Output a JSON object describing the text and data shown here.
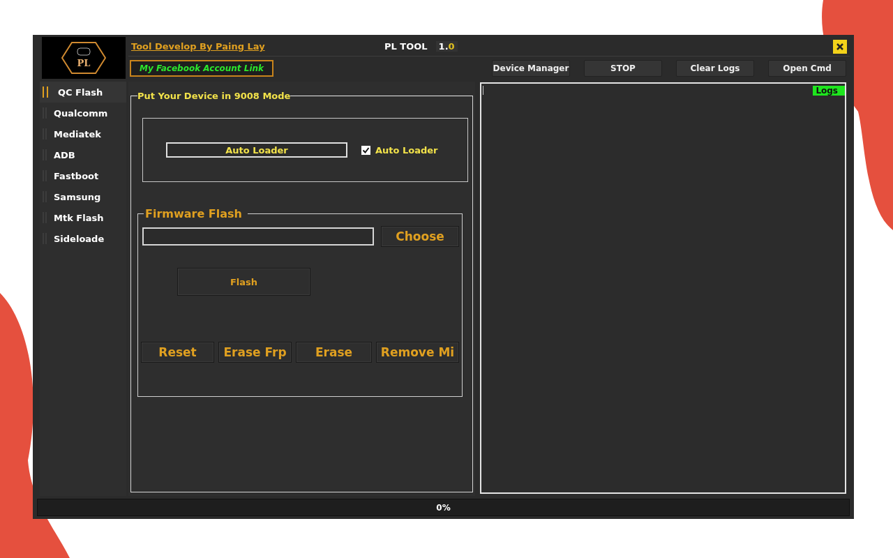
{
  "header": {
    "developer_link": "Tool Develop By Paing Lay",
    "app_name": "PL TOOL",
    "version_major": "1.",
    "version_minor": "0",
    "logo_text": "PL"
  },
  "facebook_link": "My Facebook Account Link",
  "toolbar": [
    "Device Manager",
    "STOP",
    "Clear Logs",
    "Open Cmd"
  ],
  "sidebar": {
    "items": [
      {
        "label": "QC Flash",
        "selected": true
      },
      {
        "label": "Qualcomm",
        "selected": false
      },
      {
        "label": "Mediatek",
        "selected": false
      },
      {
        "label": "ADB",
        "selected": false
      },
      {
        "label": "Fastboot",
        "selected": false
      },
      {
        "label": "Samsung",
        "selected": false
      },
      {
        "label": "Mtk Flash",
        "selected": false
      },
      {
        "label": "Sideloade",
        "selected": false
      }
    ]
  },
  "mode_group": {
    "title": "Put Your Device in 9008 Mode",
    "loader_button": "Auto Loader",
    "checkbox": {
      "label": "Auto Loader",
      "checked": true
    }
  },
  "firmware": {
    "title": "Firmware Flash",
    "choose": "Choose",
    "flash": "Flash",
    "actions": [
      "Reset",
      "Erase Frp",
      "Erase",
      "Remove Mi"
    ]
  },
  "logs": {
    "label": "Logs"
  },
  "progress": {
    "text": "0%",
    "level": 0
  }
}
